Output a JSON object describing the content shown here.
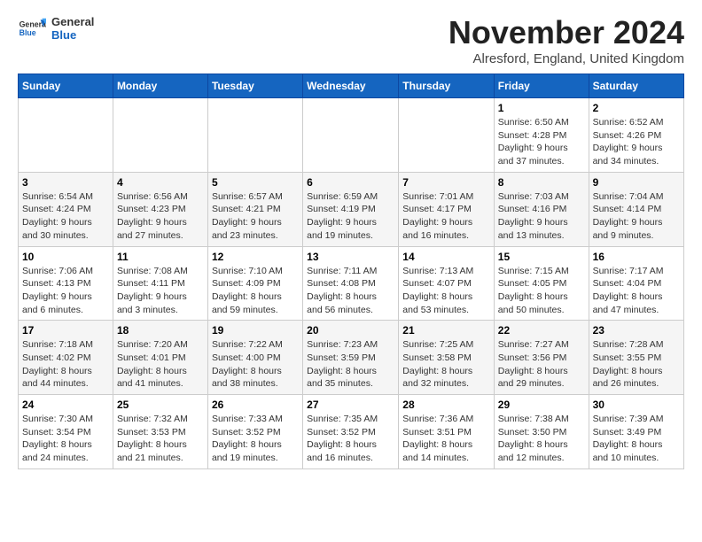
{
  "logo": {
    "general": "General",
    "blue": "Blue"
  },
  "title": "November 2024",
  "location": "Alresford, England, United Kingdom",
  "days_of_week": [
    "Sunday",
    "Monday",
    "Tuesday",
    "Wednesday",
    "Thursday",
    "Friday",
    "Saturday"
  ],
  "weeks": [
    [
      {
        "day": "",
        "detail": ""
      },
      {
        "day": "",
        "detail": ""
      },
      {
        "day": "",
        "detail": ""
      },
      {
        "day": "",
        "detail": ""
      },
      {
        "day": "",
        "detail": ""
      },
      {
        "day": "1",
        "detail": "Sunrise: 6:50 AM\nSunset: 4:28 PM\nDaylight: 9 hours and 37 minutes."
      },
      {
        "day": "2",
        "detail": "Sunrise: 6:52 AM\nSunset: 4:26 PM\nDaylight: 9 hours and 34 minutes."
      }
    ],
    [
      {
        "day": "3",
        "detail": "Sunrise: 6:54 AM\nSunset: 4:24 PM\nDaylight: 9 hours and 30 minutes."
      },
      {
        "day": "4",
        "detail": "Sunrise: 6:56 AM\nSunset: 4:23 PM\nDaylight: 9 hours and 27 minutes."
      },
      {
        "day": "5",
        "detail": "Sunrise: 6:57 AM\nSunset: 4:21 PM\nDaylight: 9 hours and 23 minutes."
      },
      {
        "day": "6",
        "detail": "Sunrise: 6:59 AM\nSunset: 4:19 PM\nDaylight: 9 hours and 19 minutes."
      },
      {
        "day": "7",
        "detail": "Sunrise: 7:01 AM\nSunset: 4:17 PM\nDaylight: 9 hours and 16 minutes."
      },
      {
        "day": "8",
        "detail": "Sunrise: 7:03 AM\nSunset: 4:16 PM\nDaylight: 9 hours and 13 minutes."
      },
      {
        "day": "9",
        "detail": "Sunrise: 7:04 AM\nSunset: 4:14 PM\nDaylight: 9 hours and 9 minutes."
      }
    ],
    [
      {
        "day": "10",
        "detail": "Sunrise: 7:06 AM\nSunset: 4:13 PM\nDaylight: 9 hours and 6 minutes."
      },
      {
        "day": "11",
        "detail": "Sunrise: 7:08 AM\nSunset: 4:11 PM\nDaylight: 9 hours and 3 minutes."
      },
      {
        "day": "12",
        "detail": "Sunrise: 7:10 AM\nSunset: 4:09 PM\nDaylight: 8 hours and 59 minutes."
      },
      {
        "day": "13",
        "detail": "Sunrise: 7:11 AM\nSunset: 4:08 PM\nDaylight: 8 hours and 56 minutes."
      },
      {
        "day": "14",
        "detail": "Sunrise: 7:13 AM\nSunset: 4:07 PM\nDaylight: 8 hours and 53 minutes."
      },
      {
        "day": "15",
        "detail": "Sunrise: 7:15 AM\nSunset: 4:05 PM\nDaylight: 8 hours and 50 minutes."
      },
      {
        "day": "16",
        "detail": "Sunrise: 7:17 AM\nSunset: 4:04 PM\nDaylight: 8 hours and 47 minutes."
      }
    ],
    [
      {
        "day": "17",
        "detail": "Sunrise: 7:18 AM\nSunset: 4:02 PM\nDaylight: 8 hours and 44 minutes."
      },
      {
        "day": "18",
        "detail": "Sunrise: 7:20 AM\nSunset: 4:01 PM\nDaylight: 8 hours and 41 minutes."
      },
      {
        "day": "19",
        "detail": "Sunrise: 7:22 AM\nSunset: 4:00 PM\nDaylight: 8 hours and 38 minutes."
      },
      {
        "day": "20",
        "detail": "Sunrise: 7:23 AM\nSunset: 3:59 PM\nDaylight: 8 hours and 35 minutes."
      },
      {
        "day": "21",
        "detail": "Sunrise: 7:25 AM\nSunset: 3:58 PM\nDaylight: 8 hours and 32 minutes."
      },
      {
        "day": "22",
        "detail": "Sunrise: 7:27 AM\nSunset: 3:56 PM\nDaylight: 8 hours and 29 minutes."
      },
      {
        "day": "23",
        "detail": "Sunrise: 7:28 AM\nSunset: 3:55 PM\nDaylight: 8 hours and 26 minutes."
      }
    ],
    [
      {
        "day": "24",
        "detail": "Sunrise: 7:30 AM\nSunset: 3:54 PM\nDaylight: 8 hours and 24 minutes."
      },
      {
        "day": "25",
        "detail": "Sunrise: 7:32 AM\nSunset: 3:53 PM\nDaylight: 8 hours and 21 minutes."
      },
      {
        "day": "26",
        "detail": "Sunrise: 7:33 AM\nSunset: 3:52 PM\nDaylight: 8 hours and 19 minutes."
      },
      {
        "day": "27",
        "detail": "Sunrise: 7:35 AM\nSunset: 3:52 PM\nDaylight: 8 hours and 16 minutes."
      },
      {
        "day": "28",
        "detail": "Sunrise: 7:36 AM\nSunset: 3:51 PM\nDaylight: 8 hours and 14 minutes."
      },
      {
        "day": "29",
        "detail": "Sunrise: 7:38 AM\nSunset: 3:50 PM\nDaylight: 8 hours and 12 minutes."
      },
      {
        "day": "30",
        "detail": "Sunrise: 7:39 AM\nSunset: 3:49 PM\nDaylight: 8 hours and 10 minutes."
      }
    ]
  ]
}
